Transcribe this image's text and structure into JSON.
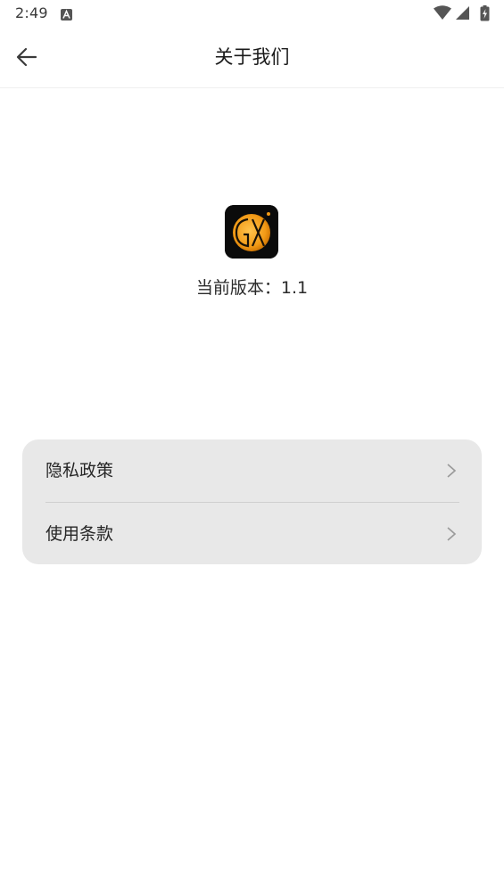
{
  "status_bar": {
    "time": "2:49",
    "notification_icon": "app-a-icon",
    "icons": [
      "wifi-icon",
      "cell-signal-icon",
      "battery-charging-icon"
    ]
  },
  "app_bar": {
    "back_icon": "arrow-left-icon",
    "title": "关于我们"
  },
  "about": {
    "logo_icon": "gx-app-logo",
    "version_label": "当前版本：",
    "version_value": "1.1"
  },
  "menu": {
    "items": [
      {
        "label": "隐私政策",
        "icon": "chevron-right-icon"
      },
      {
        "label": "使用条款",
        "icon": "chevron-right-icon"
      }
    ]
  },
  "colors": {
    "background": "#ffffff",
    "card_background": "#e8e8e8",
    "logo_background": "#0b0b0b",
    "logo_accent": "#f5a623"
  }
}
